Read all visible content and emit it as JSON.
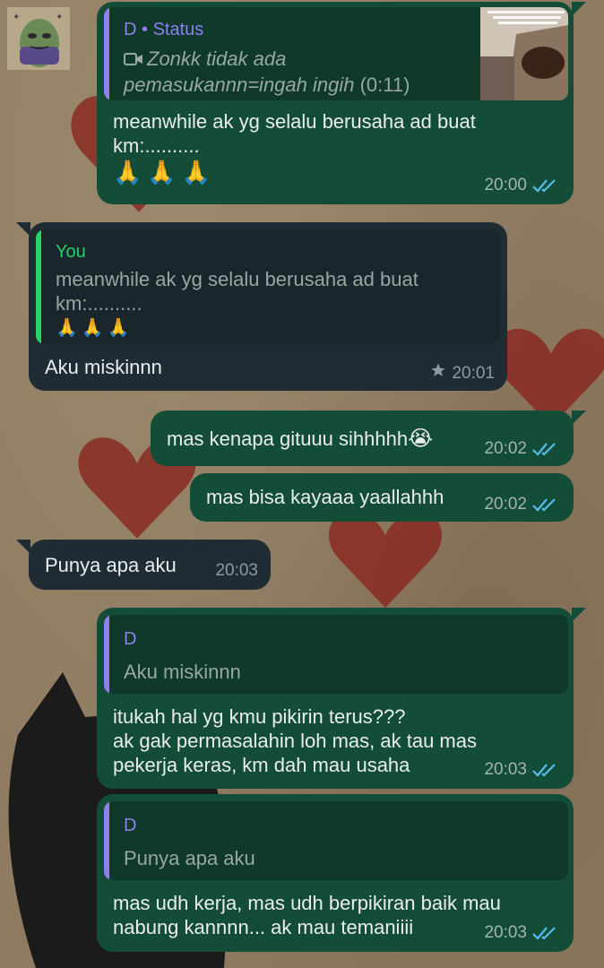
{
  "colors": {
    "outgoing_bubble": "#144d37",
    "incoming_bubble": "#1f2c34",
    "quote_bar_purple": "#8f7ff0",
    "quote_bar_green": "#25d366",
    "read_ticks": "#53bdeb"
  },
  "messages": [
    {
      "direction": "outgoing",
      "quote": {
        "author": "D",
        "source": "Status",
        "icon": "video-icon",
        "text_line1": "Zonkk tidak ada",
        "text_line2": "pemasukannn=ingah ingih",
        "duration": "(0:11)"
      },
      "text_line1": "meanwhile ak yg selalu berusaha ad buat",
      "text_line2": "km:..........",
      "emoji": "🙏🙏🙏",
      "time": "20:00",
      "status": "read"
    },
    {
      "direction": "incoming",
      "quote": {
        "author": "You",
        "text_line1": "meanwhile ak yg selalu berusaha ad buat",
        "text_line2": "km:..........",
        "emoji": "🙏🙏🙏"
      },
      "text": "Aku miskinnn",
      "starred": true,
      "time": "20:01"
    },
    {
      "direction": "outgoing",
      "text": "mas kenapa gituuu sihhhhh",
      "emoji": "😭",
      "time": "20:02",
      "status": "read"
    },
    {
      "direction": "outgoing",
      "text": "mas bisa kayaaa yaallahhh",
      "time": "20:02",
      "status": "read"
    },
    {
      "direction": "incoming",
      "text": "Punya apa aku",
      "time": "20:03"
    },
    {
      "direction": "outgoing",
      "quote": {
        "author": "D",
        "text": "Aku miskinnn"
      },
      "text_line1": "itukah hal yg kmu pikirin terus???",
      "text_line2": "ak gak permasalahin loh mas, ak tau mas",
      "text_line3": "pekerja keras, km dah mau usaha",
      "time": "20:03",
      "status": "read"
    },
    {
      "direction": "outgoing",
      "quote": {
        "author": "D",
        "text": "Punya apa aku"
      },
      "text_line1": "mas udh kerja, mas udh berpikiran baik mau",
      "text_line2": "nabung kannnn... ak mau temaniiii",
      "time": "20:03",
      "status": "read"
    }
  ]
}
